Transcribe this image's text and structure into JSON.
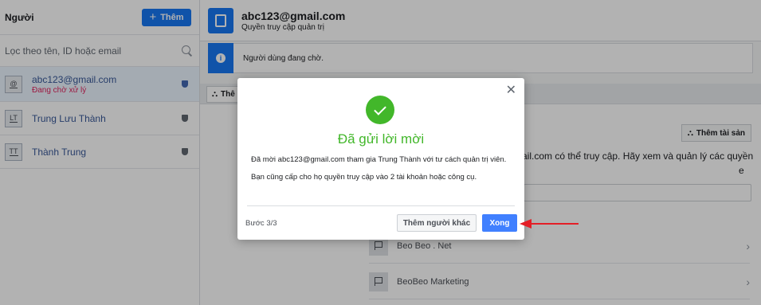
{
  "left_panel": {
    "title": "Người",
    "add_button": "Thêm",
    "filter_placeholder": "Lọc theo tên, ID hoặc email",
    "users": [
      {
        "initials": "@",
        "name": "abc123@gmail.com",
        "status": "Đang chờ xử lý"
      },
      {
        "initials": "LT",
        "name": "Trung Lưu Thành",
        "status": ""
      },
      {
        "initials": "TT",
        "name": "Thành Trung",
        "status": ""
      }
    ]
  },
  "detail": {
    "email": "abc123@gmail.com",
    "role": "Quyền truy cập quản trị",
    "pending_notice": "Người dùng đang chờ.",
    "tab_label": "Thê",
    "add_asset": "Thêm tài sản",
    "description_line1": "ail.com có thể truy cập. Hãy xem và quản lý các quyền",
    "description_line2": "e",
    "assets": [
      "Beo Beo . Net",
      "BeoBeo Marketing"
    ]
  },
  "modal": {
    "title": "Đã gửi lời mời",
    "body_p1": "Đã mời abc123@gmail.com tham gia Trung Thành với tư cách quản trị viên.",
    "body_p2": "Bạn cũng cấp cho họ quyền truy cập vào 2 tài khoản hoặc công cụ.",
    "step": "Bước 3/3",
    "secondary_button": "Thêm người khác",
    "primary_button": "Xong",
    "close_glyph": "✕"
  },
  "colors": {
    "accent": "#1877f2",
    "success": "#42b72a",
    "pending": "#e0245e",
    "annotation_arrow": "#e41e26"
  }
}
